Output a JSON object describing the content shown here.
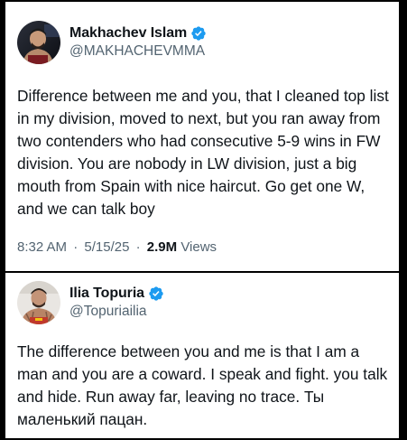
{
  "tweets": [
    {
      "author": {
        "name": "Makhachev Islam",
        "handle": "@MAKHACHEVMMA",
        "verified": true,
        "avatar_icon": "avatar-fighter-photo"
      },
      "text": "Difference between me and you, that I cleaned top list in my division, moved to next, but you ran away from two contenders who had consecutive 5-9 wins in FW division. You are nobody in LW division, just a big mouth from Spain with nice haircut. Go get one W, and we can talk boy",
      "time": "8:32 AM",
      "separator": "·",
      "date": "5/15/25",
      "views_count": "2.9M",
      "views_label": "Views"
    },
    {
      "author": {
        "name": "Ilia Topuria",
        "handle": "@Topuriailia",
        "verified": true,
        "avatar_icon": "avatar-fighter-photo"
      },
      "text": "The difference between you and me is that I am a man and you are a coward. I speak and fight. you talk and hide. Run away far, leaving no trace. Ты маленький пацан."
    }
  ],
  "colors": {
    "background": "#000000",
    "card": "#ffffff",
    "text_primary": "#0f1419",
    "text_secondary": "#536471",
    "verified_badge": "#1d9bf0"
  }
}
